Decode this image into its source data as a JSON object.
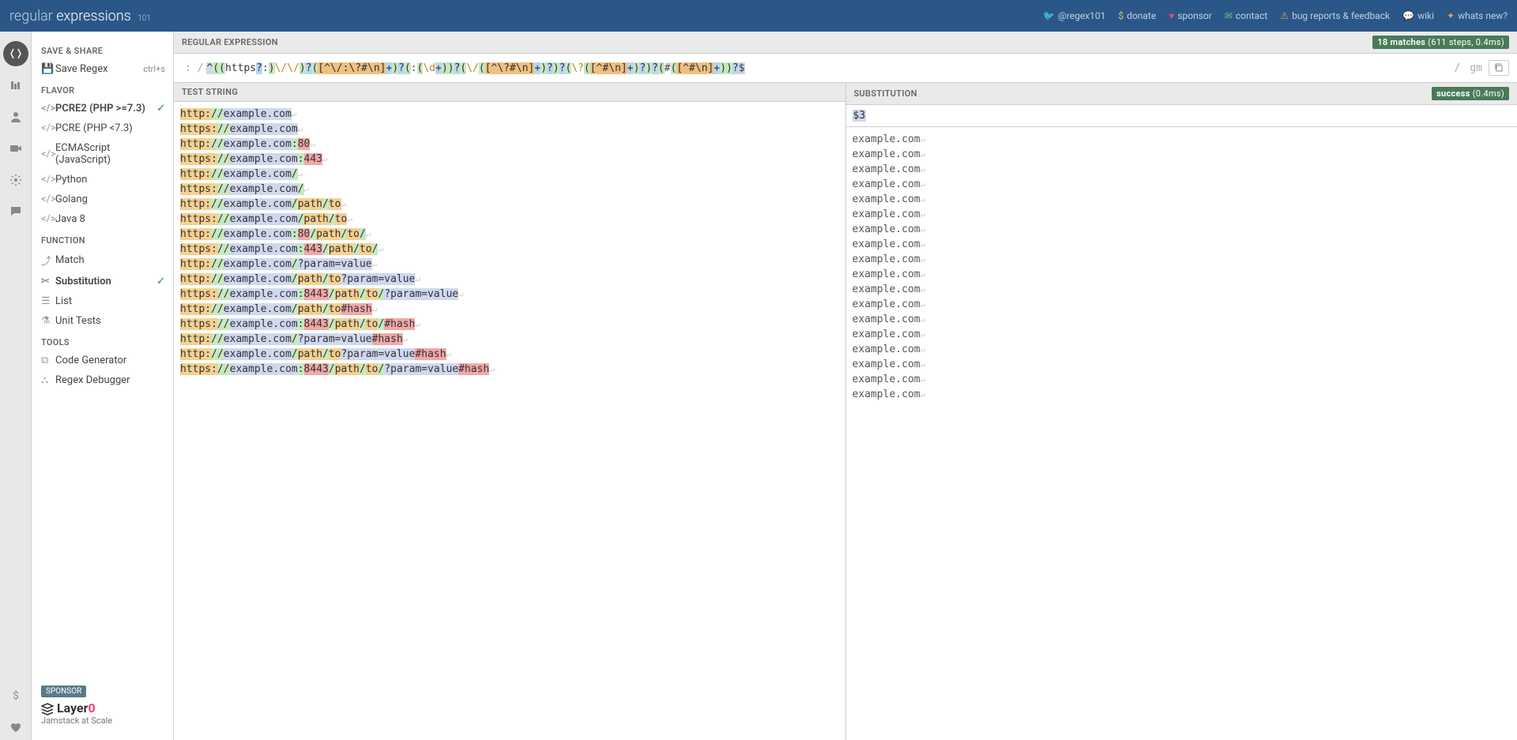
{
  "header": {
    "logo_regular": "regular",
    "logo_expressions": "expressions",
    "logo_sub": "101",
    "links": [
      {
        "icon": "twitter",
        "label": "@regex101"
      },
      {
        "icon": "dollar",
        "label": "donate"
      },
      {
        "icon": "heart",
        "label": "sponsor"
      },
      {
        "icon": "mail",
        "label": "contact"
      },
      {
        "icon": "warn",
        "label": "bug reports & feedback"
      },
      {
        "icon": "chat",
        "label": "wiki"
      },
      {
        "icon": "star",
        "label": "whats new?"
      }
    ]
  },
  "sidebar": {
    "save_share": "SAVE & SHARE",
    "save_regex": "Save Regex",
    "save_shortcut": "ctrl+s",
    "flavor": "FLAVOR",
    "flavors": [
      {
        "label": "PCRE2 (PHP >=7.3)",
        "active": true
      },
      {
        "label": "PCRE (PHP <7.3)",
        "active": false
      },
      {
        "label": "ECMAScript (JavaScript)",
        "active": false
      },
      {
        "label": "Python",
        "active": false
      },
      {
        "label": "Golang",
        "active": false
      },
      {
        "label": "Java 8",
        "active": false
      }
    ],
    "function": "FUNCTION",
    "functions": [
      {
        "label": "Match",
        "active": false
      },
      {
        "label": "Substitution",
        "active": true
      },
      {
        "label": "List",
        "active": false
      },
      {
        "label": "Unit Tests",
        "active": false
      }
    ],
    "tools": "TOOLS",
    "tool_items": [
      {
        "label": "Code Generator"
      },
      {
        "label": "Regex Debugger"
      }
    ],
    "sponsor": "SPONSOR",
    "sponsor_name": "Layer",
    "sponsor_zero": "0",
    "sponsor_tag": "Jamstack at Scale"
  },
  "panels": {
    "regex_title": "REGULAR EXPRESSION",
    "match_count": "18 matches",
    "match_stats": " (611 steps, 0.4ms)",
    "test_title": "TEST STRING",
    "sub_title": "SUBSTITUTION",
    "success": "success",
    "success_stats": " (0.4ms)",
    "regex_pattern_display": "^((https?:)\\/\\/)?([^\\/:\\?#\\n]+)?(:(\\d+))?(\\/([^\\?#\\n]+)?)?(\\?([^#\\n]+)?)?(#([^#\\n]+))?$",
    "flags": "gm",
    "sub_value": "$3"
  },
  "test_lines": [
    {
      "scheme": "http",
      "host": "example.com",
      "port": "",
      "path": "",
      "query": "",
      "hash": ""
    },
    {
      "scheme": "https",
      "host": "example.com",
      "port": "",
      "path": "",
      "query": "",
      "hash": ""
    },
    {
      "scheme": "http",
      "host": "example.com",
      "port": "80",
      "path": "",
      "query": "",
      "hash": ""
    },
    {
      "scheme": "https",
      "host": "example.com",
      "port": "443",
      "path": "",
      "query": "",
      "hash": ""
    },
    {
      "scheme": "http",
      "host": "example.com",
      "port": "",
      "path": "/",
      "query": "",
      "hash": ""
    },
    {
      "scheme": "https",
      "host": "example.com",
      "port": "",
      "path": "/",
      "query": "",
      "hash": ""
    },
    {
      "scheme": "http",
      "host": "example.com",
      "port": "",
      "path": "/path/to",
      "query": "",
      "hash": ""
    },
    {
      "scheme": "https",
      "host": "example.com",
      "port": "",
      "path": "/path/to",
      "query": "",
      "hash": ""
    },
    {
      "scheme": "http",
      "host": "example.com",
      "port": "80",
      "path": "/path/to/",
      "query": "",
      "hash": ""
    },
    {
      "scheme": "https",
      "host": "example.com",
      "port": "443",
      "path": "/path/to/",
      "query": "",
      "hash": ""
    },
    {
      "scheme": "http",
      "host": "example.com",
      "port": "",
      "path": "/",
      "query": "?param=value",
      "hash": ""
    },
    {
      "scheme": "http",
      "host": "example.com",
      "port": "",
      "path": "/path/to",
      "query": "?param=value",
      "hash": ""
    },
    {
      "scheme": "https",
      "host": "example.com",
      "port": "8443",
      "path": "/path/to/",
      "query": "?param=value",
      "hash": ""
    },
    {
      "scheme": "http",
      "host": "example.com",
      "port": "",
      "path": "/path/to",
      "query": "",
      "hash": "#hash"
    },
    {
      "scheme": "https",
      "host": "example.com",
      "port": "8443",
      "path": "/path/to/",
      "query": "",
      "hash": "#hash"
    },
    {
      "scheme": "http",
      "host": "example.com",
      "port": "",
      "path": "/",
      "query": "?param=value",
      "hash": "#hash"
    },
    {
      "scheme": "http",
      "host": "example.com",
      "port": "",
      "path": "/path/to",
      "query": "?param=value",
      "hash": "#hash"
    },
    {
      "scheme": "https",
      "host": "example.com",
      "port": "8443",
      "path": "/path/to/",
      "query": "?param=value",
      "hash": "#hash"
    }
  ],
  "sub_output_lines": [
    "example.com",
    "example.com",
    "example.com",
    "example.com",
    "example.com",
    "example.com",
    "example.com",
    "example.com",
    "example.com",
    "example.com",
    "example.com",
    "example.com",
    "example.com",
    "example.com",
    "example.com",
    "example.com",
    "example.com",
    "example.com"
  ]
}
